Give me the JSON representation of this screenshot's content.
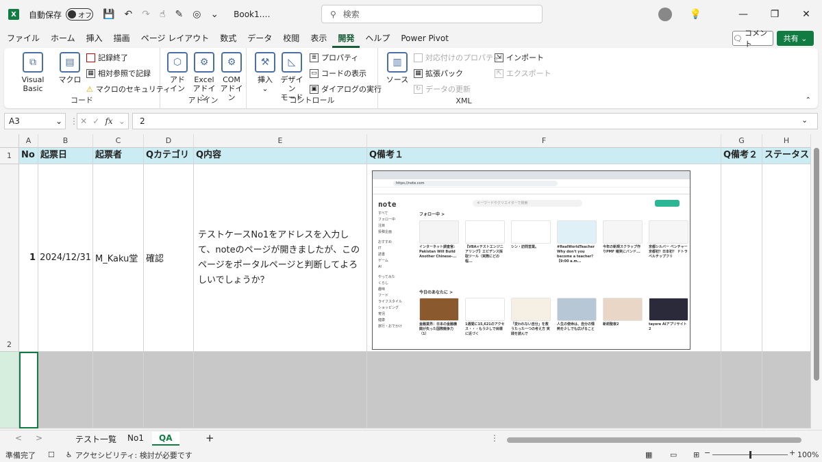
{
  "titlebar": {
    "autosave_label": "自動保存",
    "autosave_state": "オフ",
    "file_title": "Book1.…",
    "search_placeholder": "検索"
  },
  "menu": {
    "items": [
      "ファイル",
      "ホーム",
      "挿入",
      "描画",
      "ページ レイアウト",
      "数式",
      "データ",
      "校閲",
      "表示",
      "開発",
      "ヘルプ",
      "Power Pivot"
    ],
    "active": "開発",
    "comment_label": "コメント",
    "share_label": "共有"
  },
  "ribbon": {
    "code": {
      "label": "コード",
      "visual_basic": "Visual Basic",
      "macro": "マクロ",
      "record": "記録終了",
      "relative": "相対参照で記録",
      "security": "マクロのセキュリティ"
    },
    "addins": {
      "label": "アドイン",
      "addin_l1": "アド",
      "addin_l2": "イン",
      "excel_l1": "Excel",
      "excel_l2": "アドイン",
      "com_l1": "COM",
      "com_l2": "アドイン"
    },
    "controls": {
      "label": "コントロール",
      "insert_l1": "挿入",
      "insert_l2": "⌄",
      "design_l1": "デザイン",
      "design_l2": "モード",
      "properties": "プロパティ",
      "view_code": "コードの表示",
      "run_dialog": "ダイアログの実行"
    },
    "xml": {
      "label": "XML",
      "source": "ソース",
      "map_props": "対応付けのプロパティ",
      "expansion": "拡張パック",
      "refresh": "データの更新",
      "import": "インポート",
      "export": "エクスポート"
    }
  },
  "formula_bar": {
    "name_box": "A3",
    "fx": "fx",
    "value": "2"
  },
  "sheet": {
    "columns": [
      "A",
      "B",
      "C",
      "D",
      "E",
      "F",
      "G",
      "H"
    ],
    "rows": [
      "1",
      "2"
    ],
    "headers": [
      "No",
      "起票日",
      "起票者",
      "Qカテゴリ",
      "Q内容",
      "Q備考１",
      "Q備考２",
      "ステータス"
    ],
    "row2": {
      "no": "1",
      "date": "2024/12/31",
      "author": "M_Kaku堂",
      "category": "確認",
      "content": "テストケースNo1をアドレスを入力して、noteのページが開きましたが、このページをポータルページと判断してよろしいでしょうか？"
    }
  },
  "embedded_screenshot": {
    "logo": "note",
    "search_placeholder": "キーワードやクリエイターで検索",
    "follow_section": "フォロー中 >",
    "today_section": "今日のあなたに >",
    "nav_items": [
      "すべて",
      "フォロー中",
      "注目",
      "投稿企画",
      "おすすめ",
      "IT",
      "読書",
      "ゲーム",
      "AI",
      "やってみた",
      "くらし",
      "趣味",
      "フード",
      "ライフスタイル",
      "ショッピング",
      "育児",
      "健康",
      "旅行・おでかけ"
    ],
    "cards_row1": [
      "インターネット調査官: Pakistan Will Build Another Chinese-...",
      "【VBA×テストエンジニアリング】エビデンス採取ツール（実際にどの程...",
      "シン・訪問営業。",
      "#RealWorldTeacher Why don't you become a teacher？【9:00 a.m...",
      "今年の新規スクラップ作りPMF 確実にバンド...",
      "京都シルバー ベンチャー 京都初？日本初？ ドトラベルチップフリ"
    ],
    "cards_row2": [
      "金融業界：日本の金融機関が失った国際競争力（1）",
      "1週間に15,621のアクセス・・・もう少しで目標に近づく",
      "「変われない自分」を救うたった一つの考え方 実践を読んで",
      "人生の使命は、自分の情熱を少しでも広げること",
      "新莉聖夜2",
      "tayore AIアプリサイト 2"
    ]
  },
  "sheet_tabs": {
    "tabs": [
      "テスト一覧",
      "No1",
      "QA"
    ],
    "active": "QA",
    "add": "+"
  },
  "status": {
    "ready": "準備完了",
    "accessibility": "アクセシビリティ: 検討が必要です",
    "zoom": "100%"
  },
  "colors": {
    "excel_green": "#107c41",
    "header_fill": "#ccecf4",
    "row_fill": "#c8c8c8"
  }
}
